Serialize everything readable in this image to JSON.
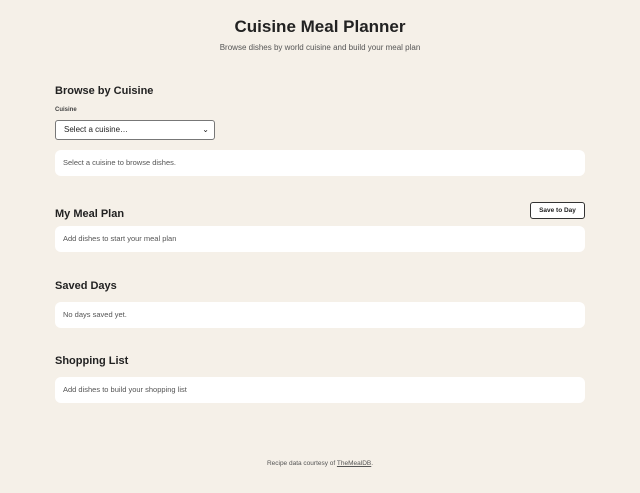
{
  "header": {
    "title": "Cuisine Meal Planner",
    "subtitle": "Browse dishes by world cuisine and build your meal plan"
  },
  "browse": {
    "title": "Browse by Cuisine",
    "cuisine_label": "Cuisine",
    "select_value": "Select a cuisine…",
    "empty_message": "Select a cuisine to browse dishes."
  },
  "meal_plan": {
    "title": "My Meal Plan",
    "save_button": "Save to Day",
    "empty_message": "Add dishes to start your meal plan"
  },
  "saved_days": {
    "title": "Saved Days",
    "empty_message": "No days saved yet."
  },
  "shopping_list": {
    "title": "Shopping List",
    "empty_message": "Add dishes to build your shopping list"
  },
  "footer": {
    "prefix": "Recipe data courtesy of ",
    "link_text": "TheMealDB",
    "suffix": "."
  },
  "icons": {
    "select_chevron": "chevron-down-icon"
  }
}
